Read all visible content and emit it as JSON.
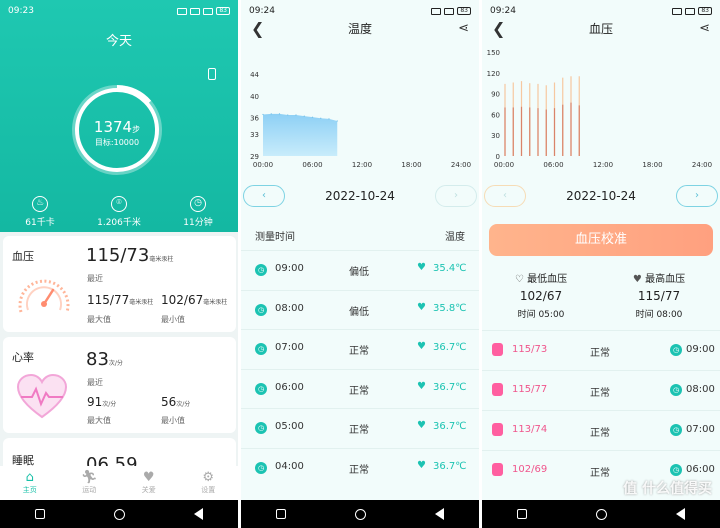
{
  "status": {
    "left": {
      "time": "09:23"
    },
    "mid": {
      "time": "09:24"
    },
    "right": {
      "time": "09:24"
    },
    "battery": "83"
  },
  "home": {
    "title": "今天",
    "steps": "1374",
    "steps_unit": "步",
    "goal": "目标:10000",
    "goal_fraction": 0.137,
    "stats": [
      {
        "icon": "flame-icon",
        "value": "61千卡"
      },
      {
        "icon": "location-icon",
        "value": "1.206千米"
      },
      {
        "icon": "clock-icon",
        "value": "11分钟"
      }
    ],
    "bp_card": {
      "title": "血压",
      "value": "115/73",
      "unit": "毫米汞柱",
      "recent": "最近",
      "max_value": "115/77",
      "max_label": "最大值",
      "min_value": "102/67",
      "min_label": "最小值"
    },
    "hr_card": {
      "title": "心率",
      "value": "83",
      "unit": "次/分",
      "recent": "最近",
      "max_value": "91",
      "max_label": "最大值",
      "min_value": "56",
      "min_label": "最小值"
    },
    "sleep_card": {
      "title": "睡眠",
      "value": "06 59"
    },
    "tabs": [
      {
        "label": "主页",
        "icon": "home-icon"
      },
      {
        "label": "运动",
        "icon": "run-icon"
      },
      {
        "label": "关爱",
        "icon": "heart-icon"
      },
      {
        "label": "设置",
        "icon": "gear-icon"
      }
    ]
  },
  "temp": {
    "title": "温度",
    "date": "2022-10-24",
    "col_time": "测量时间",
    "col_temp": "温度",
    "rows": [
      {
        "time": "09:00",
        "status": "偏低",
        "value": "35.4℃"
      },
      {
        "time": "08:00",
        "status": "偏低",
        "value": "35.8℃"
      },
      {
        "time": "07:00",
        "status": "正常",
        "value": "36.7℃"
      },
      {
        "time": "06:00",
        "status": "正常",
        "value": "36.7℃"
      },
      {
        "time": "05:00",
        "status": "正常",
        "value": "36.7℃"
      },
      {
        "time": "04:00",
        "status": "正常",
        "value": "36.7℃"
      }
    ]
  },
  "bp": {
    "title": "血压",
    "date": "2022-10-24",
    "calibrate": "血压校准",
    "low": {
      "label": "最低血压",
      "value": "102/67",
      "time": "时间 05:00"
    },
    "high": {
      "label": "最高血压",
      "value": "115/77",
      "time": "时间 08:00"
    },
    "rows": [
      {
        "value": "115/73",
        "status": "正常",
        "time": "09:00"
      },
      {
        "value": "115/77",
        "status": "正常",
        "time": "08:00"
      },
      {
        "value": "113/74",
        "status": "正常",
        "time": "07:00"
      },
      {
        "value": "102/69",
        "status": "正常",
        "time": "06:00"
      }
    ]
  },
  "watermark": "值 什么值得买",
  "chart_data": [
    {
      "type": "area",
      "x_ticks": [
        "00:00",
        "06:00",
        "12:00",
        "18:00",
        "24:00"
      ],
      "y_ticks": [
        29,
        33,
        36,
        40,
        44
      ],
      "ylim": [
        29,
        44
      ],
      "x_hours": [
        0.0,
        1.0,
        2.0,
        3.0,
        4.0,
        5.0,
        6.0,
        7.0,
        8.0,
        9.0
      ],
      "values": [
        36.6,
        36.7,
        36.7,
        36.5,
        36.5,
        36.3,
        36.1,
        35.9,
        35.8,
        35.4
      ]
    },
    {
      "type": "bar",
      "x_ticks": [
        "00:00",
        "06:00",
        "12:00",
        "18:00",
        "24:00"
      ],
      "y_ticks": [
        0,
        30,
        60,
        90,
        120,
        150
      ],
      "ylim": [
        0,
        150
      ],
      "x_hours": [
        0,
        1,
        2,
        3,
        4,
        5,
        6,
        7,
        8,
        9
      ],
      "systolic": [
        104,
        106,
        108,
        105,
        104,
        102,
        106,
        113,
        115,
        115
      ],
      "diastolic": [
        70,
        70,
        71,
        70,
        69,
        67,
        69,
        74,
        77,
        73
      ]
    }
  ]
}
